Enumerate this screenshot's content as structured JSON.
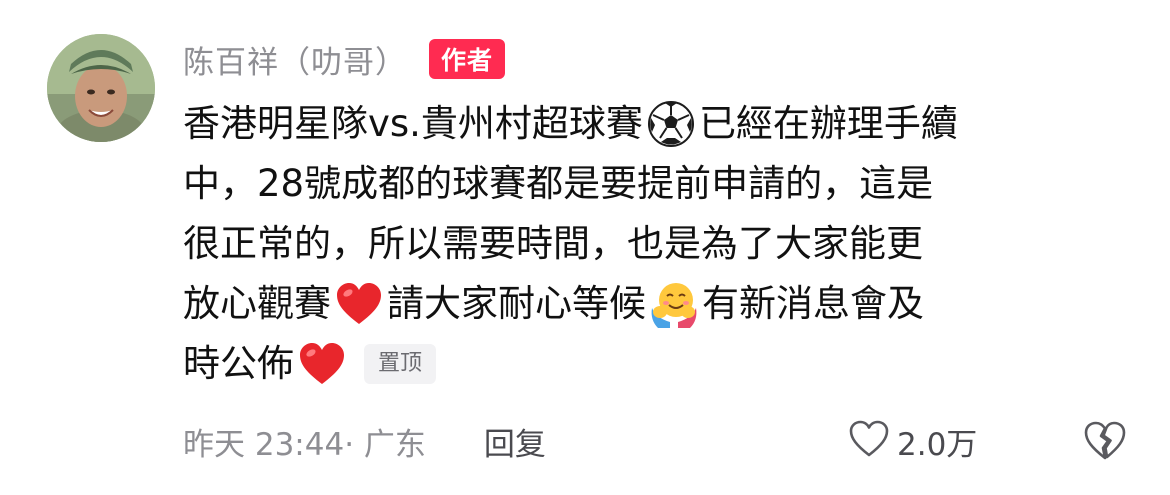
{
  "comment": {
    "username": "陈百祥（叻哥）",
    "author_badge": "作者",
    "text_lines": [
      [
        "香港明星隊vs.貴州村超球賽",
        "已經在辦理手續"
      ],
      [
        "中，28號成都的球賽都是要提前申請的，這是"
      ],
      [
        "很正常的，所以需要時間，也是為了大家能更"
      ],
      [
        "放心觀賽",
        "請大家耐心等候",
        "有新消息會及"
      ],
      [
        "時公佈"
      ]
    ],
    "emojis": {
      "soccer": "soccer-ball-emoji",
      "heart": "red-heart-emoji",
      "hug": "hugging-face-emoji"
    },
    "pinned_label": "置顶",
    "timestamp": "昨天 23:44· 广东",
    "reply_label": "回复",
    "like_count": "2.0万"
  },
  "colors": {
    "author_badge_bg": "#ff2b51",
    "muted_text": "#8e8e93",
    "body_text": "#111111"
  }
}
